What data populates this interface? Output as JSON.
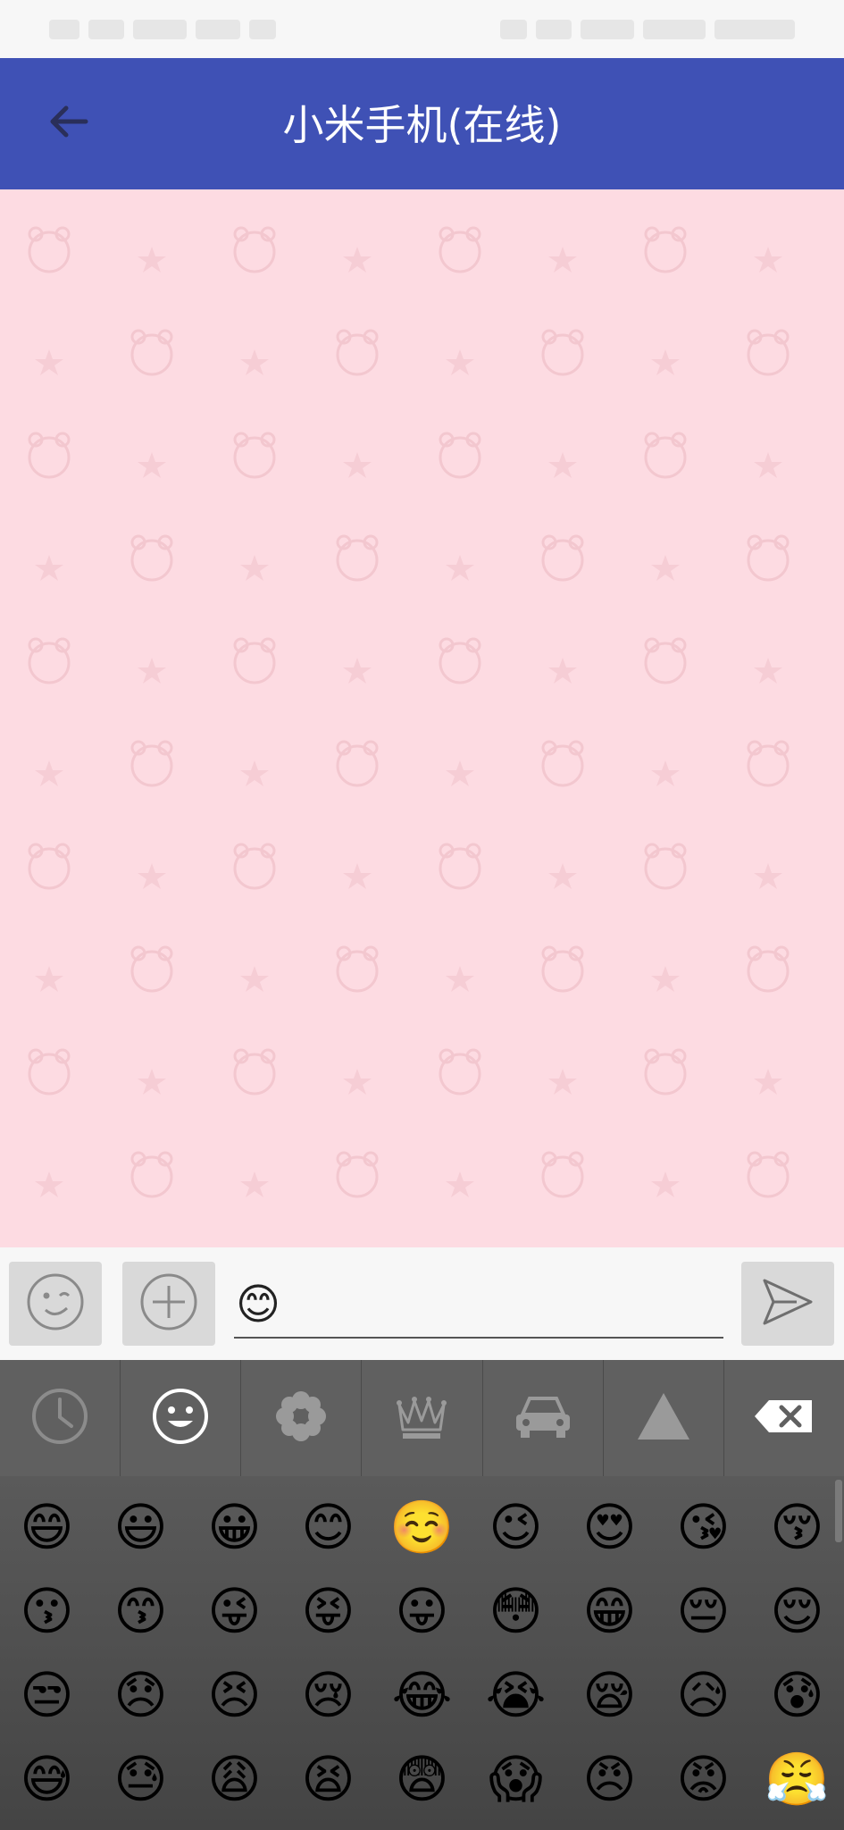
{
  "header": {
    "title": "小米手机(在线)"
  },
  "composer": {
    "input_value": "😊",
    "input_placeholder": ""
  },
  "emoji_tabs": [
    {
      "name": "recent",
      "icon": "clock-icon"
    },
    {
      "name": "smileys",
      "icon": "smiley-icon"
    },
    {
      "name": "nature",
      "icon": "flower-icon"
    },
    {
      "name": "objects",
      "icon": "crown-icon"
    },
    {
      "name": "places",
      "icon": "car-icon"
    },
    {
      "name": "symbols",
      "icon": "triangle-icon"
    },
    {
      "name": "backspace",
      "icon": "backspace-icon"
    }
  ],
  "emoji_grid": [
    "😄",
    "😃",
    "😀",
    "😊",
    "☺️",
    "😉",
    "😍",
    "😘",
    "😚",
    "😗",
    "😙",
    "😜",
    "😝",
    "😛",
    "😳",
    "😁",
    "😔",
    "😌",
    "😒",
    "😞",
    "😣",
    "😢",
    "😂",
    "😭",
    "😪",
    "😥",
    "😰",
    "😅",
    "😓",
    "😩",
    "😫",
    "😨",
    "😱",
    "😠",
    "😡",
    "😤",
    "😖",
    "😆",
    "😋",
    "😷",
    "😎",
    "😴",
    "😵",
    "😲",
    "😟"
  ],
  "colors": {
    "app_bar": "#3f51b5",
    "chat_background": "#fddbe2",
    "emoji_tabs_bg": "#606060"
  }
}
